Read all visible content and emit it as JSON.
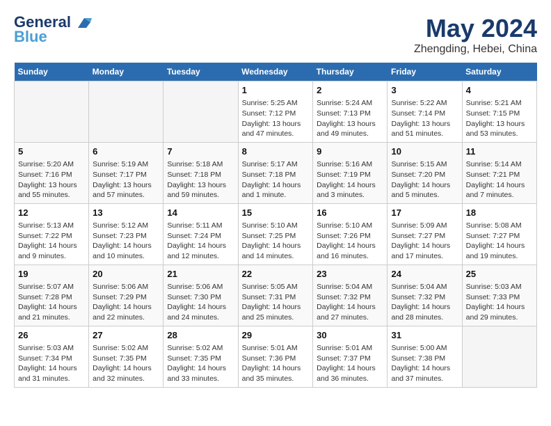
{
  "header": {
    "logo_line1": "General",
    "logo_line2": "Blue",
    "month_title": "May 2024",
    "location": "Zhengding, Hebei, China"
  },
  "weekdays": [
    "Sunday",
    "Monday",
    "Tuesday",
    "Wednesday",
    "Thursday",
    "Friday",
    "Saturday"
  ],
  "weeks": [
    [
      {
        "day": "",
        "empty": true
      },
      {
        "day": "",
        "empty": true
      },
      {
        "day": "",
        "empty": true
      },
      {
        "day": "1",
        "info": "Sunrise: 5:25 AM\nSunset: 7:12 PM\nDaylight: 13 hours and 47 minutes."
      },
      {
        "day": "2",
        "info": "Sunrise: 5:24 AM\nSunset: 7:13 PM\nDaylight: 13 hours and 49 minutes."
      },
      {
        "day": "3",
        "info": "Sunrise: 5:22 AM\nSunset: 7:14 PM\nDaylight: 13 hours and 51 minutes."
      },
      {
        "day": "4",
        "info": "Sunrise: 5:21 AM\nSunset: 7:15 PM\nDaylight: 13 hours and 53 minutes."
      }
    ],
    [
      {
        "day": "5",
        "info": "Sunrise: 5:20 AM\nSunset: 7:16 PM\nDaylight: 13 hours and 55 minutes."
      },
      {
        "day": "6",
        "info": "Sunrise: 5:19 AM\nSunset: 7:17 PM\nDaylight: 13 hours and 57 minutes."
      },
      {
        "day": "7",
        "info": "Sunrise: 5:18 AM\nSunset: 7:18 PM\nDaylight: 13 hours and 59 minutes."
      },
      {
        "day": "8",
        "info": "Sunrise: 5:17 AM\nSunset: 7:18 PM\nDaylight: 14 hours and 1 minute."
      },
      {
        "day": "9",
        "info": "Sunrise: 5:16 AM\nSunset: 7:19 PM\nDaylight: 14 hours and 3 minutes."
      },
      {
        "day": "10",
        "info": "Sunrise: 5:15 AM\nSunset: 7:20 PM\nDaylight: 14 hours and 5 minutes."
      },
      {
        "day": "11",
        "info": "Sunrise: 5:14 AM\nSunset: 7:21 PM\nDaylight: 14 hours and 7 minutes."
      }
    ],
    [
      {
        "day": "12",
        "info": "Sunrise: 5:13 AM\nSunset: 7:22 PM\nDaylight: 14 hours and 9 minutes."
      },
      {
        "day": "13",
        "info": "Sunrise: 5:12 AM\nSunset: 7:23 PM\nDaylight: 14 hours and 10 minutes."
      },
      {
        "day": "14",
        "info": "Sunrise: 5:11 AM\nSunset: 7:24 PM\nDaylight: 14 hours and 12 minutes."
      },
      {
        "day": "15",
        "info": "Sunrise: 5:10 AM\nSunset: 7:25 PM\nDaylight: 14 hours and 14 minutes."
      },
      {
        "day": "16",
        "info": "Sunrise: 5:10 AM\nSunset: 7:26 PM\nDaylight: 14 hours and 16 minutes."
      },
      {
        "day": "17",
        "info": "Sunrise: 5:09 AM\nSunset: 7:27 PM\nDaylight: 14 hours and 17 minutes."
      },
      {
        "day": "18",
        "info": "Sunrise: 5:08 AM\nSunset: 7:27 PM\nDaylight: 14 hours and 19 minutes."
      }
    ],
    [
      {
        "day": "19",
        "info": "Sunrise: 5:07 AM\nSunset: 7:28 PM\nDaylight: 14 hours and 21 minutes."
      },
      {
        "day": "20",
        "info": "Sunrise: 5:06 AM\nSunset: 7:29 PM\nDaylight: 14 hours and 22 minutes."
      },
      {
        "day": "21",
        "info": "Sunrise: 5:06 AM\nSunset: 7:30 PM\nDaylight: 14 hours and 24 minutes."
      },
      {
        "day": "22",
        "info": "Sunrise: 5:05 AM\nSunset: 7:31 PM\nDaylight: 14 hours and 25 minutes."
      },
      {
        "day": "23",
        "info": "Sunrise: 5:04 AM\nSunset: 7:32 PM\nDaylight: 14 hours and 27 minutes."
      },
      {
        "day": "24",
        "info": "Sunrise: 5:04 AM\nSunset: 7:32 PM\nDaylight: 14 hours and 28 minutes."
      },
      {
        "day": "25",
        "info": "Sunrise: 5:03 AM\nSunset: 7:33 PM\nDaylight: 14 hours and 29 minutes."
      }
    ],
    [
      {
        "day": "26",
        "info": "Sunrise: 5:03 AM\nSunset: 7:34 PM\nDaylight: 14 hours and 31 minutes."
      },
      {
        "day": "27",
        "info": "Sunrise: 5:02 AM\nSunset: 7:35 PM\nDaylight: 14 hours and 32 minutes."
      },
      {
        "day": "28",
        "info": "Sunrise: 5:02 AM\nSunset: 7:35 PM\nDaylight: 14 hours and 33 minutes."
      },
      {
        "day": "29",
        "info": "Sunrise: 5:01 AM\nSunset: 7:36 PM\nDaylight: 14 hours and 35 minutes."
      },
      {
        "day": "30",
        "info": "Sunrise: 5:01 AM\nSunset: 7:37 PM\nDaylight: 14 hours and 36 minutes."
      },
      {
        "day": "31",
        "info": "Sunrise: 5:00 AM\nSunset: 7:38 PM\nDaylight: 14 hours and 37 minutes."
      },
      {
        "day": "",
        "empty": true
      }
    ]
  ]
}
